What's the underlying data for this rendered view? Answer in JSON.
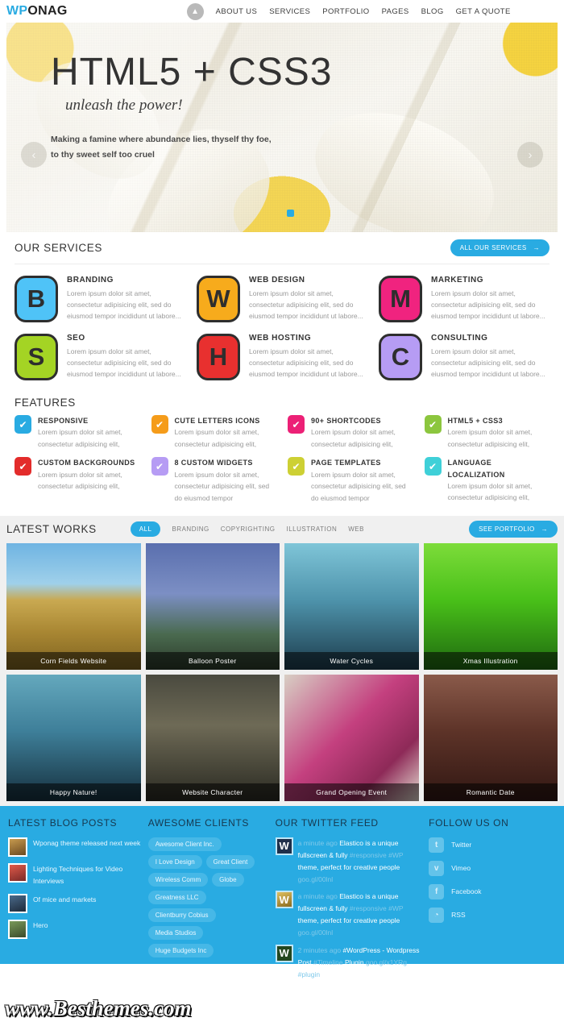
{
  "header": {
    "logo": {
      "part1": "WP",
      "part2": "ON",
      "part3": "AG"
    },
    "home_icon": "home-icon",
    "nav": [
      {
        "label": "ABOUT US"
      },
      {
        "label": "SERVICES"
      },
      {
        "label": "PORTFOLIO"
      },
      {
        "label": "PAGES"
      },
      {
        "label": "BLOG"
      },
      {
        "label": "GET A QUOTE"
      }
    ]
  },
  "hero": {
    "title": "HTML5 + CSS3",
    "subtitle": "unleash the power!",
    "line1": "Making a famine where abundance lies, thyself thy foe,",
    "line2": "to thy sweet self too cruel",
    "prev": "‹",
    "next": "›"
  },
  "services": {
    "title": "OUR SERVICES",
    "button": "ALL OUR SERVICES",
    "button_arrow": "→",
    "items": [
      {
        "letter": "B",
        "color": "#4fc3f7",
        "name": "BRANDING",
        "desc": "Lorem ipsum dolor sit amet, consectetur adipisicing elit, sed do eiusmod tempor incididunt ut labore..."
      },
      {
        "letter": "W",
        "color": "#f7ab1c",
        "name": "WEB DESIGN",
        "desc": "Lorem ipsum dolor sit amet, consectetur adipisicing elit, sed do eiusmod tempor incididunt ut labore..."
      },
      {
        "letter": "M",
        "color": "#f0237f",
        "name": "MARKETING",
        "desc": "Lorem ipsum dolor sit amet, consectetur adipisicing elit, sed do eiusmod tempor incididunt ut labore..."
      },
      {
        "letter": "S",
        "color": "#a4d424",
        "name": "SEO",
        "desc": "Lorem ipsum dolor sit amet, consectetur adipisicing elit, sed do eiusmod tempor incididunt ut labore..."
      },
      {
        "letter": "H",
        "color": "#e8302f",
        "name": "WEB HOSTING",
        "desc": "Lorem ipsum dolor sit amet, consectetur adipisicing elit, sed do eiusmod tempor incididunt ut labore..."
      },
      {
        "letter": "C",
        "color": "#b69cf4",
        "name": "CONSULTING",
        "desc": "Lorem ipsum dolor sit amet, consectetur adipisicing elit, sed do eiusmod tempor incididunt ut labore..."
      }
    ]
  },
  "features": {
    "title": "FEATURES",
    "check_glyph": "✔",
    "items": [
      {
        "color": "#29abe2",
        "name": "RESPONSIVE",
        "desc": "Lorem ipsum dolor sit amet, consectetur adipisicing elit,"
      },
      {
        "color": "#f59c1a",
        "name": "CUTE LETTERS ICONS",
        "desc": "Lorem ipsum dolor sit amet, consectetur adipisicing elit,"
      },
      {
        "color": "#ec2076",
        "name": "90+ SHORTCODES",
        "desc": "Lorem ipsum dolor sit amet, consectetur adipisicing elit,"
      },
      {
        "color": "#8cc63e",
        "name": "HTML5 + CSS3",
        "desc": "Lorem ipsum dolor sit amet, consectetur adipisicing elit,"
      },
      {
        "color": "#e32c2b",
        "name": "CUSTOM BACKGROUNDS",
        "desc": "Lorem ipsum dolor sit amet, consectetur adipisicing elit,"
      },
      {
        "color": "#b69cf4",
        "name": "8 CUSTOM WIDGETS",
        "desc": "Lorem ipsum dolor sit amet, consectetur adipisicing elit, sed do eiusmod tempor"
      },
      {
        "color": "#cdd034",
        "name": "PAGE TEMPLATES",
        "desc": "Lorem ipsum dolor sit amet, consectetur adipisicing elit, sed do eiusmod tempor"
      },
      {
        "color": "#3fd0d8",
        "name": "LANGUAGE LOCALIZATION",
        "desc": "Lorem ipsum dolor sit amet, consectetur adipisicing elit,"
      }
    ]
  },
  "works": {
    "title": "LATEST WORKS",
    "filters": [
      {
        "label": "ALL",
        "active": true
      },
      {
        "label": "BRANDING",
        "active": false
      },
      {
        "label": "COPYRIGHTING",
        "active": false
      },
      {
        "label": "ILLUSTRATION",
        "active": false
      },
      {
        "label": "WEB",
        "active": false
      }
    ],
    "button": "SEE PORTFOLIO",
    "button_arrow": "→",
    "items": [
      {
        "caption": "Corn Fields Website"
      },
      {
        "caption": "Balloon Poster"
      },
      {
        "caption": "Water Cycles"
      },
      {
        "caption": "Xmas Illustration"
      },
      {
        "caption": "Happy Nature!"
      },
      {
        "caption": "Website Character"
      },
      {
        "caption": "Grand Opening Event"
      },
      {
        "caption": "Romantic Date"
      }
    ]
  },
  "footer": {
    "blog": {
      "title": "LATEST BLOG POSTS",
      "items": [
        {
          "text": "Wponag theme released next week"
        },
        {
          "text": "Lighting Techniques for Video Interviews"
        },
        {
          "text": "Of mice and markets"
        },
        {
          "text": "Hero"
        }
      ]
    },
    "clients": {
      "title": "AWESOME CLIENTS",
      "items": [
        {
          "label": "Awesome Client Inc."
        },
        {
          "label": "I Love Design"
        },
        {
          "label": "Great Client"
        },
        {
          "label": "Wireless Comm"
        },
        {
          "label": "Globe"
        },
        {
          "label": "Greatness LLC"
        },
        {
          "label": "Clientburry Cobius"
        },
        {
          "label": "Media Studios"
        },
        {
          "label": "Huge Budgets Inc"
        }
      ]
    },
    "twitter": {
      "title": "OUR TWITTER FEED",
      "items": [
        {
          "icon": "W",
          "time": "a minute ago",
          "text1": "Elastico is a unique fullscreen & fully",
          "tags": "#responsive #WP",
          "text2": "theme, perfect for creative people",
          "link": "goo.gl/00lnl"
        },
        {
          "icon": "W",
          "time": "a minute ago",
          "text1": "Elastico is a unique fullscreen & fully",
          "tags": "#responsive #WP",
          "text2": "theme, perfect for creative people",
          "link": "goo.gl/00lnl"
        },
        {
          "icon": "W",
          "time": "2 minutes ago",
          "text1": "#WordPress - Wordpress Post",
          "tags": "#Timeline",
          "text2": "Plugin",
          "link": "goo.gl/x1YRg #plugin"
        }
      ]
    },
    "follow": {
      "title": "FOLLOW US ON",
      "items": [
        {
          "icon": "twitter-icon",
          "glyph": "t",
          "label": "Twitter"
        },
        {
          "icon": "vimeo-icon",
          "glyph": "v",
          "label": "Vimeo"
        },
        {
          "icon": "facebook-icon",
          "glyph": "f",
          "label": "Facebook"
        },
        {
          "icon": "rss-icon",
          "glyph": "◔",
          "label": "RSS"
        }
      ]
    }
  },
  "watermark": "www.Besthemes.com"
}
